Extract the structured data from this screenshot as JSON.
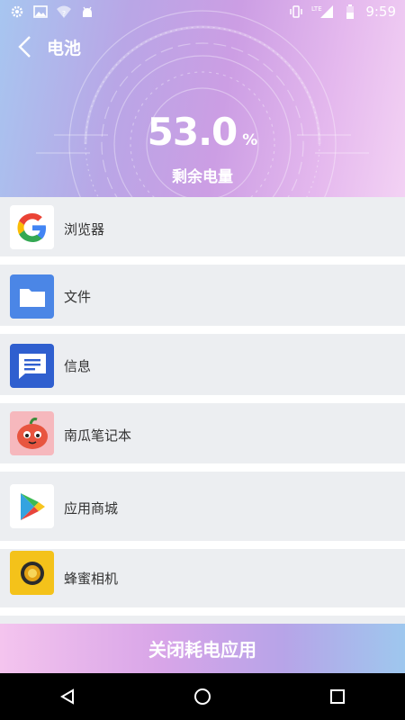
{
  "status_bar": {
    "time": "9:59",
    "network": "LTE",
    "left_icons": [
      "settings-icon",
      "image-icon",
      "wifi-question-icon",
      "android-icon"
    ],
    "right_icons": [
      "vibrate-icon",
      "signal-icon",
      "battery-icon"
    ]
  },
  "header": {
    "title": "电池",
    "back_icon": "back-arrow-icon"
  },
  "battery": {
    "value": "53.0",
    "unit": "%",
    "label": "剩余电量"
  },
  "apps": [
    {
      "name": "浏览器",
      "icon": "google-icon"
    },
    {
      "name": "文件",
      "icon": "folder-icon"
    },
    {
      "name": "信息",
      "icon": "messages-icon"
    },
    {
      "name": "南瓜笔记本",
      "icon": "pumpkin-icon"
    },
    {
      "name": "应用商城",
      "icon": "play-store-icon"
    },
    {
      "name": "蜂蜜相机",
      "icon": "honey-camera-icon"
    }
  ],
  "action": {
    "label": "关闭耗电应用"
  },
  "colors": {
    "hero_start": "#a7c6f0",
    "hero_mid": "#cc9ee4",
    "hero_end": "#f3d2f4",
    "list_bg": "#eceef1",
    "separator": "#ffffff"
  }
}
